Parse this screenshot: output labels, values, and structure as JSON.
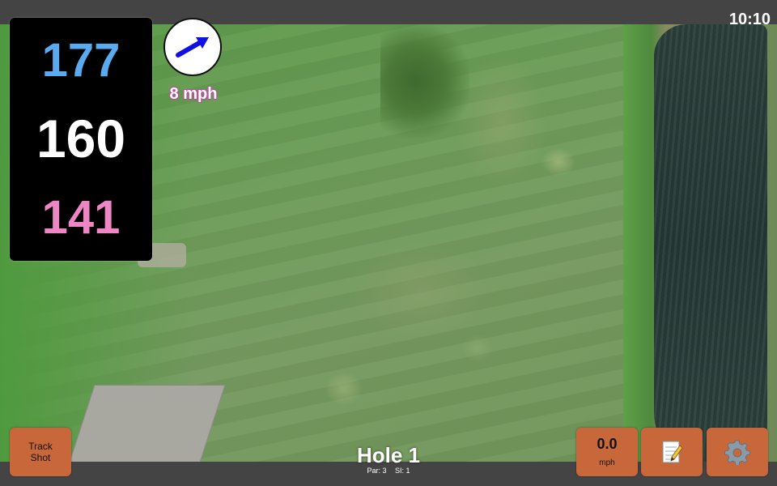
{
  "status": {
    "time": "10:10"
  },
  "distances": {
    "back": "177",
    "middle": "160",
    "front": "141"
  },
  "wind": {
    "speed": "8 mph",
    "arrow_icon": "wind-arrow-icon",
    "arrow_color": "#1010e0"
  },
  "track_shot": {
    "line1": "Track",
    "line2": "Shot"
  },
  "speed_meter": {
    "value": "0.0",
    "unit": "mph"
  },
  "hole": {
    "title": "Hole 1",
    "par": "Par: 3",
    "si": "SI: 1"
  },
  "icons": {
    "notes": "notepad-icon",
    "settings": "gear-icon"
  },
  "colors": {
    "accent": "#c04aa0",
    "button": "#c8683a",
    "back_distance": "#5aaaf0",
    "front_distance": "#ee86c6"
  }
}
